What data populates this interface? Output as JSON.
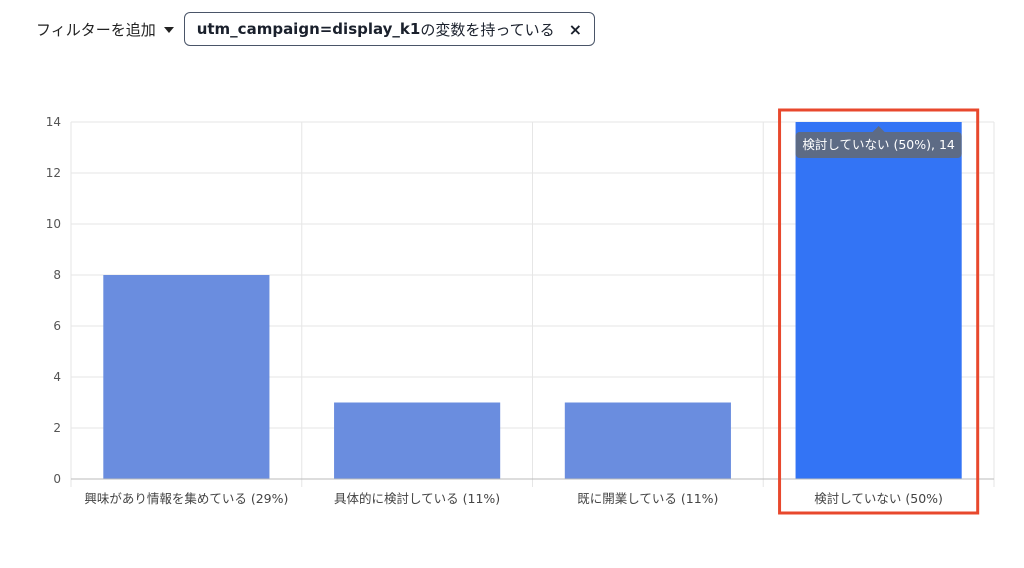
{
  "filter": {
    "add_label": "フィルターを追加",
    "chip_key": "utm_campaign=display_k1",
    "chip_suffix": "の変数を持っている",
    "chip_close": "×"
  },
  "tooltip": {
    "text": "検討していない (50%), 14"
  },
  "chart_data": {
    "type": "bar",
    "categories": [
      "興味があり情報を集めている (29%)",
      "具体的に検討している (11%)",
      "既に開業している (11%)",
      "検討していない (50%)"
    ],
    "values": [
      8,
      3,
      3,
      14
    ],
    "highlighted_index": 3,
    "ylim": [
      0,
      14
    ],
    "yticks": [
      0,
      2,
      4,
      6,
      8,
      10,
      12,
      14
    ],
    "grid": true,
    "bar_color": "#6a8ddf",
    "highlight_color": "#3374f5",
    "highlight_box_color": "#e8482d"
  }
}
